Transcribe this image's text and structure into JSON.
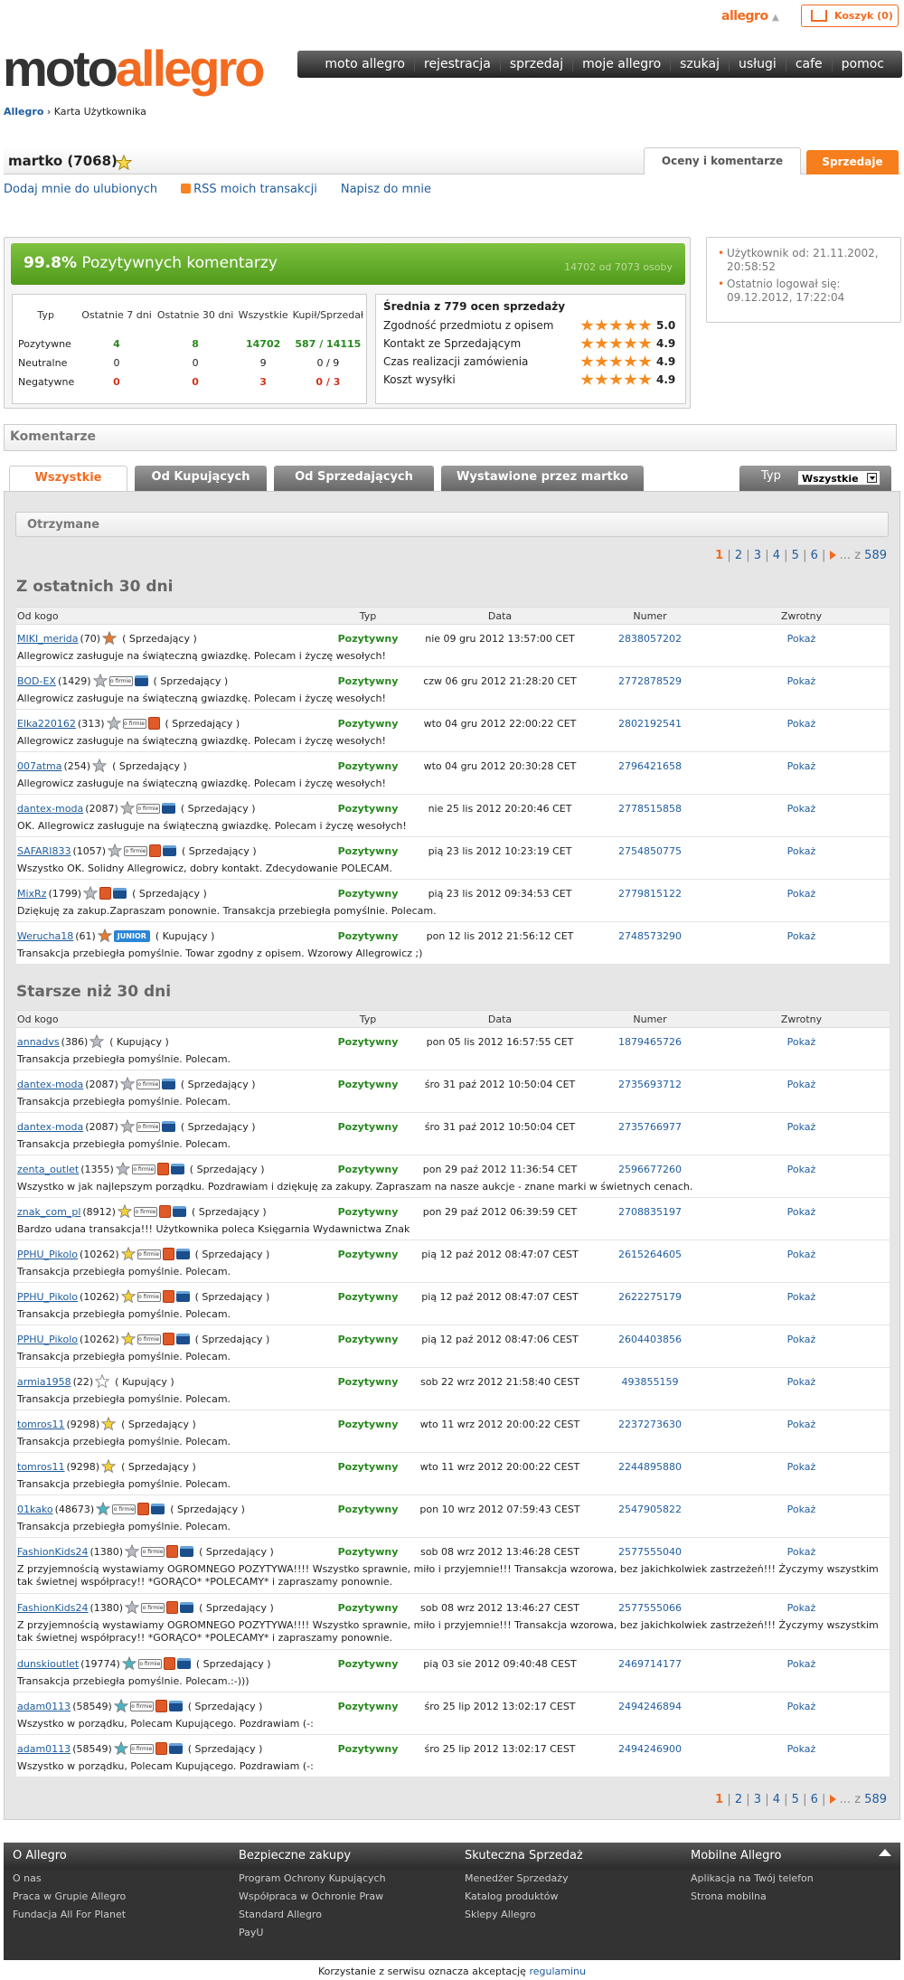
{
  "top": {
    "allegro_label": "allegro",
    "cart_label": "Koszyk (0)"
  },
  "logo": {
    "part1": "moto",
    "part2": "allegro"
  },
  "nav": [
    "moto allegro",
    "rejestracja",
    "sprzedaj",
    "moje allegro",
    "szukaj",
    "usługi",
    "cafe",
    "pomoc"
  ],
  "breadcrumb": {
    "root": "Allegro",
    "sep": "›",
    "current": "Karta Użytkownika"
  },
  "user": {
    "name": "martko (7068)",
    "tab_oceny": "Oceny i komentarze",
    "tab_sprzedaje": "Sprzedaje"
  },
  "userlinks": {
    "fav": "Dodaj mnie do ulubionych",
    "rss": "RSS moich transakcji",
    "write": "Napisz do mnie"
  },
  "summary": {
    "pct": "99.8%",
    "pct_label": "Pozytywnych komentarzy",
    "pct_small": "14702 od 7073 osoby",
    "headers": [
      "Typ",
      "Ostatnie 7 dni",
      "Ostatnie 30 dni",
      "Wszystkie",
      "Kupił/Sprzedał"
    ],
    "rows": [
      {
        "label": "Pozytywne",
        "d7": "4",
        "d30": "8",
        "all": "14702",
        "ks": "587 / 14115",
        "cls": "pos"
      },
      {
        "label": "Neutralne",
        "d7": "0",
        "d30": "0",
        "all": "9",
        "ks": "0 / 9",
        "cls": ""
      },
      {
        "label": "Negatywne",
        "d7": "0",
        "d30": "0",
        "all": "3",
        "ks": "0 / 3",
        "cls": "neg"
      }
    ]
  },
  "ratings": {
    "title": "Średnia z 779 ocen sprzedaży",
    "items": [
      {
        "label": "Zgodność przedmiotu z opisem",
        "value": "5.0"
      },
      {
        "label": "Kontakt ze Sprzedającym",
        "value": "4.9"
      },
      {
        "label": "Czas realizacji zamówienia",
        "value": "4.9"
      },
      {
        "label": "Koszt wysyłki",
        "value": "4.9"
      }
    ]
  },
  "side": {
    "since": "Użytkownik od: 21.11.2002, 20:58:52",
    "lastlogin": "Ostatnio logował się: 09.12.2012, 17:22:04"
  },
  "komentarze": {
    "title": "Komentarze"
  },
  "filter_tabs": [
    "Wszystkie",
    "Od Kupujących",
    "Od Sprzedających",
    "Wystawione przez martko"
  ],
  "typ": {
    "label": "Typ",
    "value": "Wszystkie"
  },
  "otrzymane": "Otrzymane",
  "pager": {
    "pages": [
      "1",
      "2",
      "3",
      "4",
      "5",
      "6"
    ],
    "suffix": "... z",
    "total": "589"
  },
  "columns": [
    "Od kogo",
    "Typ",
    "Data",
    "Numer",
    "Zwrotny"
  ],
  "section1": {
    "title": "Z ostatnich 30 dni",
    "rows": [
      {
        "user": "MIKI_merida",
        "count": "(70)",
        "icons": [
          "star-orange"
        ],
        "role": "( Sprzedający )",
        "typ": "Pozytywny",
        "date": "nie 09 gru 2012 13:57:00 CET",
        "num": "2838057202",
        "zw": "Pokaż",
        "text": "Allegrowicz zasługuje na świąteczną gwiazdkę. Polecam i życzę wesołych!"
      },
      {
        "user": "BOD-EX",
        "count": "(1429)",
        "icons": [
          "star-silver",
          "ofirmie",
          "case"
        ],
        "role": "( Sprzedający )",
        "typ": "Pozytywny",
        "date": "czw 06 gru 2012 21:28:20 CET",
        "num": "2772878529",
        "zw": "Pokaż",
        "text": "Allegrowicz zasługuje na świąteczną gwiazdkę. Polecam i życzę wesołych!"
      },
      {
        "user": "Elka220162",
        "count": "(313)",
        "icons": [
          "star-silver",
          "ofirmie",
          "bag"
        ],
        "role": "( Sprzedający )",
        "typ": "Pozytywny",
        "date": "wto 04 gru 2012 22:00:22 CET",
        "num": "2802192541",
        "zw": "Pokaż",
        "text": "Allegrowicz zasługuje na świąteczną gwiazdkę. Polecam i życzę wesołych!"
      },
      {
        "user": "007atma",
        "count": "(254)",
        "icons": [
          "star-silver"
        ],
        "role": "( Sprzedający )",
        "typ": "Pozytywny",
        "date": "wto 04 gru 2012 20:30:28 CET",
        "num": "2796421658",
        "zw": "Pokaż",
        "text": "Allegrowicz zasługuje na świąteczną gwiazdkę. Polecam i życzę wesołych!"
      },
      {
        "user": "dantex-moda",
        "count": "(2087)",
        "icons": [
          "star-silver",
          "ofirmie",
          "case"
        ],
        "role": "( Sprzedający )",
        "typ": "Pozytywny",
        "date": "nie 25 lis 2012 20:20:46 CET",
        "num": "2778515858",
        "zw": "Pokaż",
        "text": "OK. Allegrowicz zasługuje na świąteczną gwiazdkę. Polecam i życzę wesołych!"
      },
      {
        "user": "SAFARI833",
        "count": "(1057)",
        "icons": [
          "star-silver",
          "ofirmie",
          "bag",
          "case"
        ],
        "role": "( Sprzedający )",
        "typ": "Pozytywny",
        "date": "pią 23 lis 2012 10:23:19 CET",
        "num": "2754850775",
        "zw": "Pokaż",
        "text": "Wszystko OK. Solidny Allegrowicz, dobry kontakt. Zdecydowanie POLECAM."
      },
      {
        "user": "MixRz",
        "count": "(1799)",
        "icons": [
          "star-silver",
          "bag",
          "case"
        ],
        "role": "( Sprzedający )",
        "typ": "Pozytywny",
        "date": "pią 23 lis 2012 09:34:53 CET",
        "num": "2779815122",
        "zw": "Pokaż",
        "text": "Dziękuję za zakup.Zapraszam ponownie. Transakcja przebiegła pomyślnie. Polecam."
      },
      {
        "user": "Werucha18",
        "count": "(61)",
        "icons": [
          "star-orange",
          "junior"
        ],
        "role": "( Kupujący )",
        "typ": "Pozytywny",
        "date": "pon 12 lis 2012 21:56:12 CET",
        "num": "2748573290",
        "zw": "Pokaż",
        "text": "Transakcja przebiegła pomyślnie. Towar zgodny z opisem. Wzorowy Allegrowicz ;)"
      }
    ]
  },
  "section2": {
    "title": "Starsze niż 30 dni",
    "rows": [
      {
        "user": "annadvs",
        "count": "(386)",
        "icons": [
          "star-silver"
        ],
        "role": "( Kupujący )",
        "typ": "Pozytywny",
        "date": "pon 05 lis 2012 16:57:55 CET",
        "num": "1879465726",
        "zw": "Pokaż",
        "text": "Transakcja przebiegła pomyślnie. Polecam."
      },
      {
        "user": "dantex-moda",
        "count": "(2087)",
        "icons": [
          "star-silver",
          "ofirmie",
          "case"
        ],
        "role": "( Sprzedający )",
        "typ": "Pozytywny",
        "date": "śro 31 paź 2012 10:50:04 CET",
        "num": "2735693712",
        "zw": "Pokaż",
        "text": "Transakcja przebiegła pomyślnie. Polecam."
      },
      {
        "user": "dantex-moda",
        "count": "(2087)",
        "icons": [
          "star-silver",
          "ofirmie",
          "case"
        ],
        "role": "( Sprzedający )",
        "typ": "Pozytywny",
        "date": "śro 31 paź 2012 10:50:04 CET",
        "num": "2735766977",
        "zw": "Pokaż",
        "text": "Transakcja przebiegła pomyślnie. Polecam."
      },
      {
        "user": "zenta_outlet",
        "count": "(1355)",
        "icons": [
          "star-silver",
          "ofirmie",
          "bag",
          "case"
        ],
        "role": "( Sprzedający )",
        "typ": "Pozytywny",
        "date": "pon 29 paź 2012 11:36:54 CET",
        "num": "2596677260",
        "zw": "Pokaż",
        "text": "Wszystko w jak najlepszym porządku. Pozdrawiam i dziękuję za zakupy. Zapraszam na nasze aukcje - znane marki w świetnych cenach."
      },
      {
        "user": "znak_com_pl",
        "count": "(8912)",
        "icons": [
          "star-gold",
          "ofirmie",
          "bag",
          "case"
        ],
        "role": "( Sprzedający )",
        "typ": "Pozytywny",
        "date": "pon 29 paź 2012 06:39:59 CET",
        "num": "2708835197",
        "zw": "Pokaż",
        "text": "Bardzo udana transakcja!!! Użytkownika poleca Księgarnia Wydawnictwa Znak"
      },
      {
        "user": "PPHU_Pikolo",
        "count": "(10262)",
        "icons": [
          "star-gold",
          "ofirmie",
          "bag",
          "case"
        ],
        "role": "( Sprzedający )",
        "typ": "Pozytywny",
        "date": "pią 12 paź 2012 08:47:07 CEST",
        "num": "2615264605",
        "zw": "Pokaż",
        "text": "Transakcja przebiegła pomyślnie. Polecam."
      },
      {
        "user": "PPHU_Pikolo",
        "count": "(10262)",
        "icons": [
          "star-gold",
          "ofirmie",
          "bag",
          "case"
        ],
        "role": "( Sprzedający )",
        "typ": "Pozytywny",
        "date": "pią 12 paź 2012 08:47:07 CEST",
        "num": "2622275179",
        "zw": "Pokaż",
        "text": "Transakcja przebiegła pomyślnie. Polecam."
      },
      {
        "user": "PPHU_Pikolo",
        "count": "(10262)",
        "icons": [
          "star-gold",
          "ofirmie",
          "bag",
          "case"
        ],
        "role": "( Sprzedający )",
        "typ": "Pozytywny",
        "date": "pią 12 paź 2012 08:47:06 CEST",
        "num": "2604403856",
        "zw": "Pokaż",
        "text": "Transakcja przebiegła pomyślnie. Polecam."
      },
      {
        "user": "armia1958",
        "count": "(22)",
        "icons": [
          "star-white"
        ],
        "role": "( Kupujący )",
        "typ": "Pozytywny",
        "date": "sob 22 wrz 2012 21:58:40 CEST",
        "num": "493855159",
        "zw": "Pokaż",
        "text": "Transakcja przebiegła pomyślnie. Polecam."
      },
      {
        "user": "tomros11",
        "count": "(9298)",
        "icons": [
          "star-gold"
        ],
        "role": "( Sprzedający )",
        "typ": "Pozytywny",
        "date": "wto 11 wrz 2012 20:00:22 CEST",
        "num": "2237273630",
        "zw": "Pokaż",
        "text": "Transakcja przebiegła pomyślnie. Polecam."
      },
      {
        "user": "tomros11",
        "count": "(9298)",
        "icons": [
          "star-gold"
        ],
        "role": "( Sprzedający )",
        "typ": "Pozytywny",
        "date": "wto 11 wrz 2012 20:00:22 CEST",
        "num": "2244895880",
        "zw": "Pokaż",
        "text": "Transakcja przebiegła pomyślnie. Polecam."
      },
      {
        "user": "01kako",
        "count": "(48673)",
        "icons": [
          "star-teal",
          "ofirmie",
          "bag",
          "case"
        ],
        "role": "( Sprzedający )",
        "typ": "Pozytywny",
        "date": "pon 10 wrz 2012 07:59:43 CEST",
        "num": "2547905822",
        "zw": "Pokaż",
        "text": "Transakcja przebiegła pomyślnie. Polecam."
      },
      {
        "user": "FashionKids24",
        "count": "(1380)",
        "icons": [
          "star-silver",
          "ofirmie",
          "bag",
          "case"
        ],
        "role": "( Sprzedający )",
        "typ": "Pozytywny",
        "date": "sob 08 wrz 2012 13:46:28 CEST",
        "num": "2577555040",
        "zw": "Pokaż",
        "text": "Z przyjemnością wystawiamy OGROMNEGO POZYTYWA!!!! Wszystko sprawnie, miło i przyjemnie!!! Transakcja wzorowa, bez jakichkolwiek zastrzeżeń!!! Życzymy wszystkim tak świetnej współpracy!! *GORĄCO* *POLECAMY* i zapraszamy ponownie.",
        "tall": true
      },
      {
        "user": "FashionKids24",
        "count": "(1380)",
        "icons": [
          "star-silver",
          "ofirmie",
          "bag",
          "case"
        ],
        "role": "( Sprzedający )",
        "typ": "Pozytywny",
        "date": "sob 08 wrz 2012 13:46:27 CEST",
        "num": "2577555066",
        "zw": "Pokaż",
        "text": "Z przyjemnością wystawiamy OGROMNEGO POZYTYWA!!!! Wszystko sprawnie, miło i przyjemnie!!! Transakcja wzorowa, bez jakichkolwiek zastrzeżeń!!! Życzymy wszystkim tak świetnej współpracy!! *GORĄCO* *POLECAMY* i zapraszamy ponownie.",
        "tall": true
      },
      {
        "user": "dunskioutlet",
        "count": "(19774)",
        "icons": [
          "star-teal",
          "ofirmie",
          "bag",
          "case"
        ],
        "role": "( Sprzedający )",
        "typ": "Pozytywny",
        "date": "pią 03 sie 2012 09:40:48 CEST",
        "num": "2469714177",
        "zw": "Pokaż",
        "text": "Transakcja przebiegła pomyślnie. Polecam.:-)))"
      },
      {
        "user": "adam0113",
        "count": "(58549)",
        "icons": [
          "star-teal",
          "ofirmie",
          "bag",
          "case"
        ],
        "role": "( Sprzedający )",
        "typ": "Pozytywny",
        "date": "śro 25 lip 2012 13:02:17 CEST",
        "num": "2494246894",
        "zw": "Pokaż",
        "text": "Wszystko w porządku, Polecam Kupującego. Pozdrawiam (-:"
      },
      {
        "user": "adam0113",
        "count": "(58549)",
        "icons": [
          "star-teal",
          "ofirmie",
          "bag",
          "case"
        ],
        "role": "( Sprzedający )",
        "typ": "Pozytywny",
        "date": "śro 25 lip 2012 13:02:17 CEST",
        "num": "2494246900",
        "zw": "Pokaż",
        "text": "Wszystko w porządku, Polecam Kupującego. Pozdrawiam (-:"
      }
    ]
  },
  "footer": {
    "cols": [
      {
        "title": "O Allegro",
        "items": [
          "O nas",
          "Praca w Grupie Allegro",
          "Fundacja All For Planet"
        ]
      },
      {
        "title": "Bezpieczne zakupy",
        "items": [
          "Program Ochrony Kupujących",
          "Współpraca w Ochronie Praw",
          "Standard Allegro",
          "PayU"
        ]
      },
      {
        "title": "Skuteczna Sprzedaż",
        "items": [
          "Menedżer Sprzedaży",
          "Katalog produktów",
          "Sklepy Allegro"
        ]
      },
      {
        "title": "Mobilne Allegro",
        "items": [
          "Aplikacja na Twój telefon",
          "Strona mobilna"
        ]
      }
    ]
  },
  "bottom": {
    "text": "Korzystanie z serwisu oznacza akceptację",
    "link": "regulaminu"
  },
  "colors": {
    "accent": "#f26b21",
    "positive": "#27891e",
    "negative": "#d3341c",
    "link": "#1f5c9d"
  }
}
